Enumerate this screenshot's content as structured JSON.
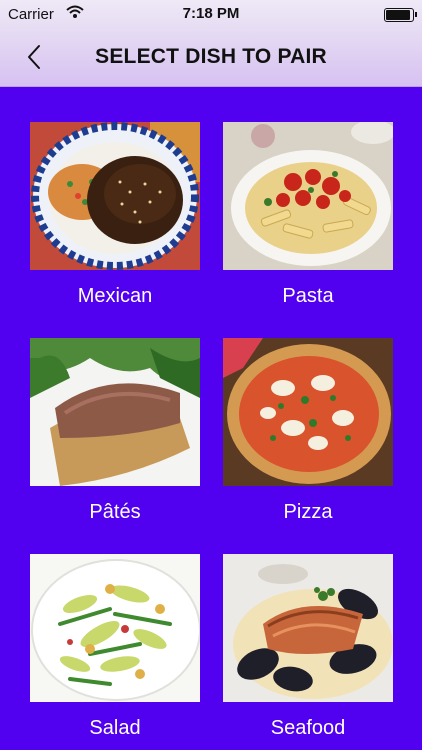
{
  "status_bar": {
    "carrier": "Carrier",
    "time": "7:18 PM"
  },
  "nav": {
    "title": "SELECT DISH TO PAIR"
  },
  "dishes": [
    {
      "label": "Mexican"
    },
    {
      "label": "Pasta"
    },
    {
      "label": "Pâtés"
    },
    {
      "label": "Pizza"
    },
    {
      "label": "Salad"
    },
    {
      "label": "Seafood"
    }
  ],
  "colors": {
    "background": "#5100f0",
    "nav_tint": "#d7c1f2",
    "label_text": "#ffffff"
  },
  "icons": {
    "back": "chevron-left-icon",
    "wifi": "wifi-icon",
    "battery": "battery-icon"
  }
}
